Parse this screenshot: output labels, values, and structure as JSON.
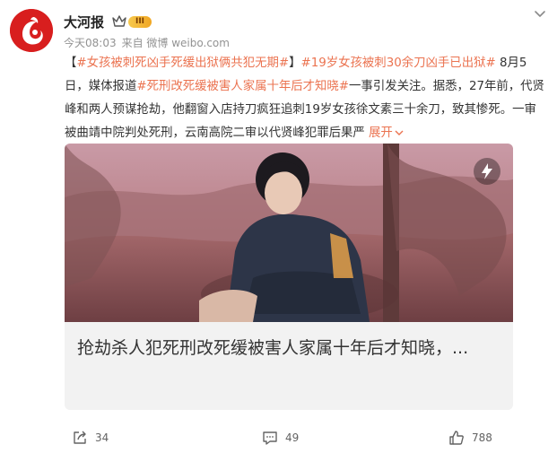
{
  "post": {
    "author": "大河报",
    "level_badge": "III",
    "time": "今天08:03",
    "source": "来自 微博 weibo.com",
    "content": {
      "bracket_open": "【",
      "hashtag1": "#女孩被刺死凶手死缓出狱俩共犯无期#",
      "bracket_close": "】",
      "hashtag2": "#19岁女孩被刺30余刀凶手已出狱#",
      "text1": " 8月5日，媒体报道",
      "hashtag3": "#死刑改死缓被害人家属十年后才知晓#",
      "text2": "一事引发关注。据悉，27年前，代贤峰和两人预谋抢劫，他翻窗入店持刀疯狂追刺19岁女孩徐文素三十余刀，致其惨死。一审被曲靖中院判处死刑，云南高院二审以代贤峰犯罪后果严 ",
      "expand": "展开"
    },
    "card": {
      "title": "抢劫杀人犯死刑改死缓被害人家属十年后才知晓，..."
    },
    "actions": {
      "repost": "34",
      "comment": "49",
      "like": "788"
    }
  },
  "colors": {
    "accent": "#eb7350",
    "brand_red": "#d81e1e",
    "meta_gray": "#939393"
  },
  "icons": [
    "more-chevron-icon",
    "crown-icon",
    "flash-icon",
    "repost-icon",
    "comment-icon",
    "like-icon"
  ]
}
